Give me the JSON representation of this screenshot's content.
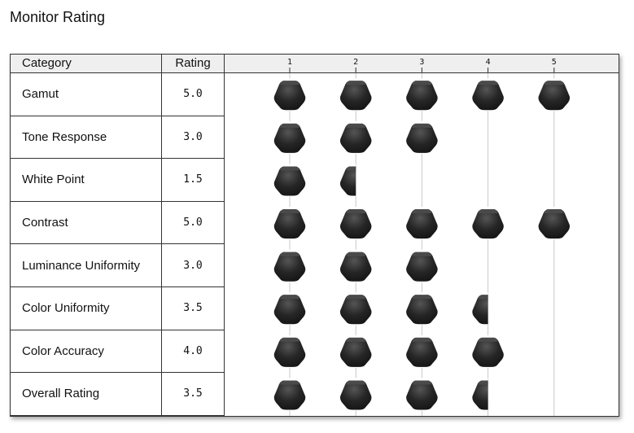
{
  "title": "Monitor Rating",
  "headers": {
    "category": "Category",
    "rating": "Rating"
  },
  "scale": [
    "1",
    "2",
    "3",
    "4",
    "5"
  ],
  "rows": [
    {
      "category": "Gamut",
      "rating": "5.0",
      "value": 5.0
    },
    {
      "category": "Tone Response",
      "rating": "3.0",
      "value": 3.0
    },
    {
      "category": "White Point",
      "rating": "1.5",
      "value": 1.5
    },
    {
      "category": "Contrast",
      "rating": "5.0",
      "value": 5.0
    },
    {
      "category": "Luminance Uniformity",
      "rating": "3.0",
      "value": 3.0
    },
    {
      "category": "Color Uniformity",
      "rating": "3.5",
      "value": 3.5
    },
    {
      "category": "Color Accuracy",
      "rating": "4.0",
      "value": 4.0
    },
    {
      "category": "Overall Rating",
      "rating": "3.5",
      "value": 3.5
    }
  ],
  "colors": {
    "knob": "#222222",
    "grid": "#c8c8c8",
    "border": "#333333"
  },
  "icon": "knob-icon"
}
